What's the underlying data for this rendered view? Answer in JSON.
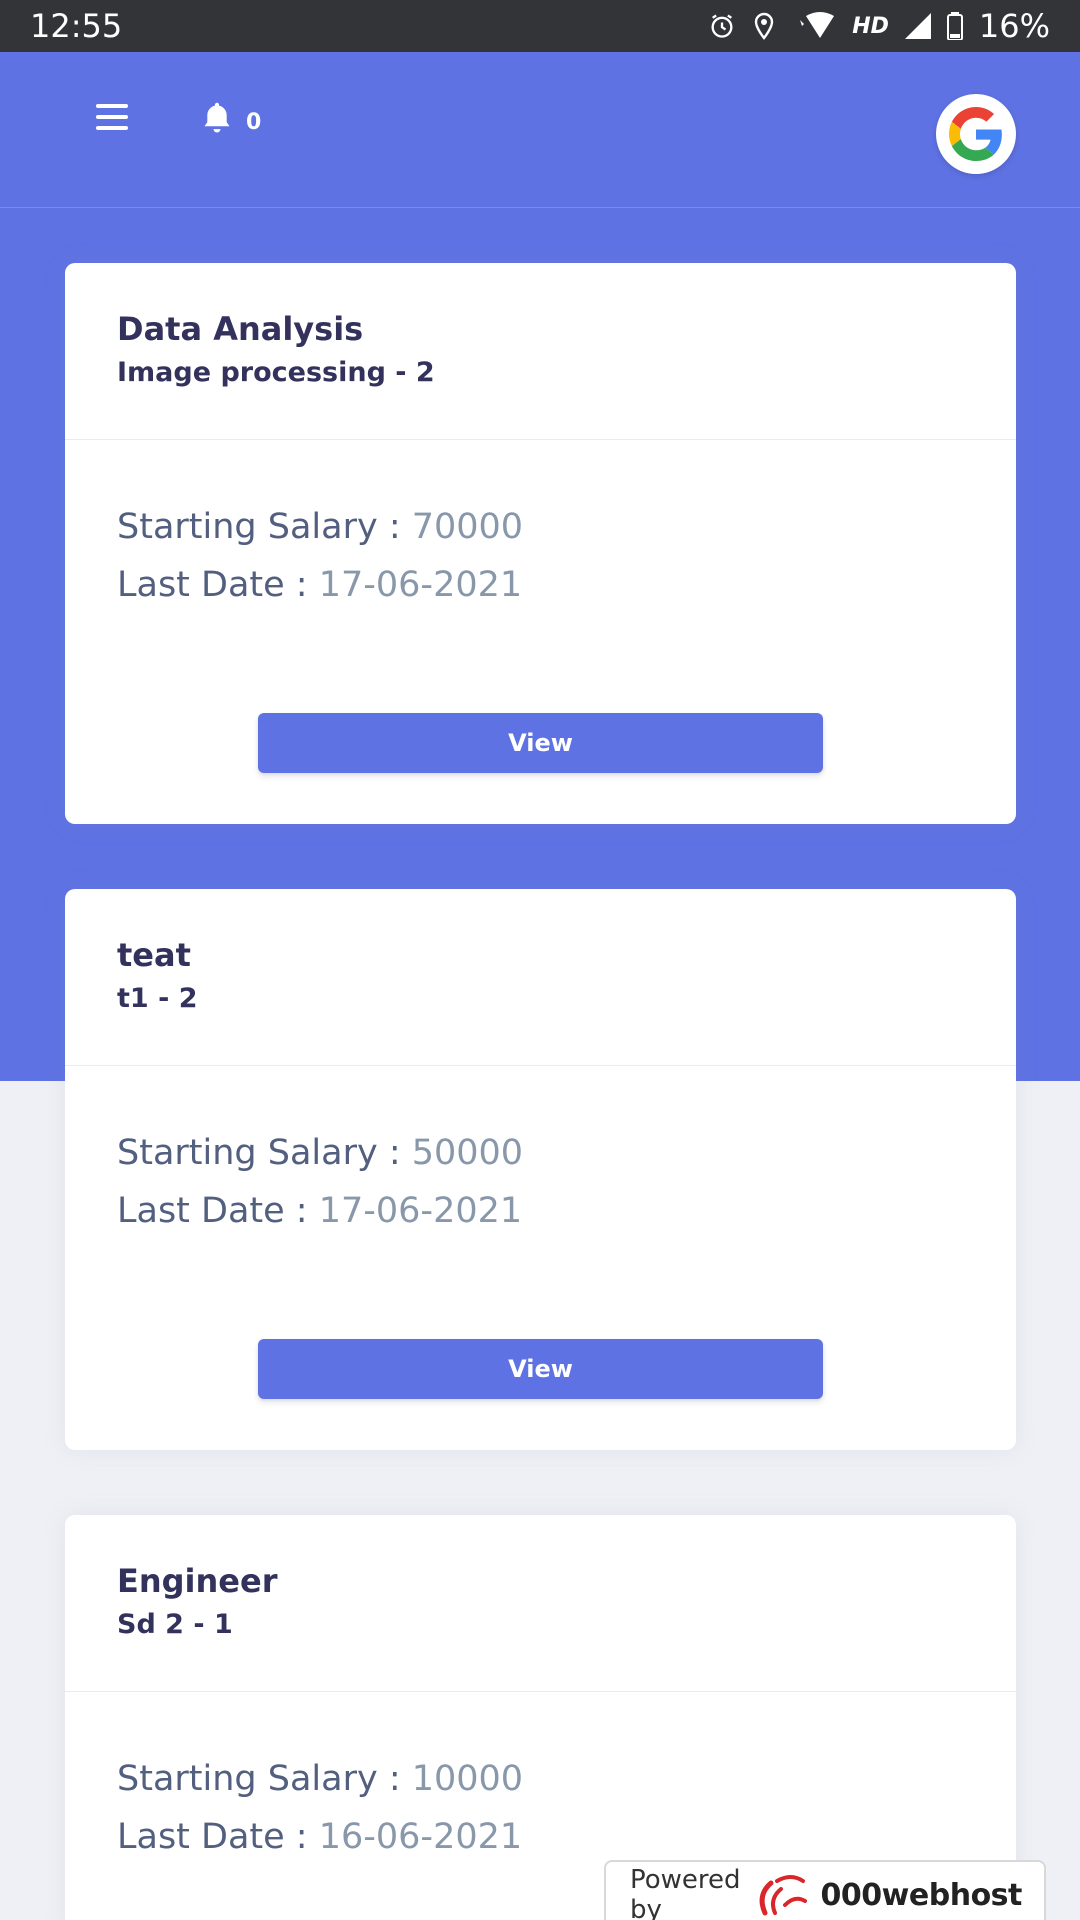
{
  "status_bar": {
    "time": "12:55",
    "network": "HD",
    "battery": "16%",
    "icons": [
      "alarm-icon",
      "location-icon",
      "wifi-icon",
      "signal-icon",
      "battery-icon"
    ]
  },
  "header": {
    "notification_count": "0",
    "icons": [
      "menu-icon",
      "bell-icon",
      "google-icon"
    ]
  },
  "jobs": [
    {
      "title": "Data Analysis",
      "subtitle": "Image processing - 2",
      "salary_label": "Starting Salary : ",
      "salary": "70000",
      "date_label": "Last Date : ",
      "last_date": "17-06-2021",
      "button": "View"
    },
    {
      "title": "teat",
      "subtitle": "t1 - 2",
      "salary_label": "Starting Salary : ",
      "salary": "50000",
      "date_label": "Last Date : ",
      "last_date": "17-06-2021",
      "button": "View"
    },
    {
      "title": "Engineer",
      "subtitle": "Sd 2 - 1",
      "salary_label": "Starting Salary : ",
      "salary": "10000",
      "date_label": "Last Date : ",
      "last_date": "16-06-2021"
    }
  ],
  "footer": {
    "powered_by": "Powered by",
    "brand": "000webhost"
  },
  "colors": {
    "primary": "#5e72e4",
    "status_bar": "#323437",
    "background": "#eef0f5"
  }
}
